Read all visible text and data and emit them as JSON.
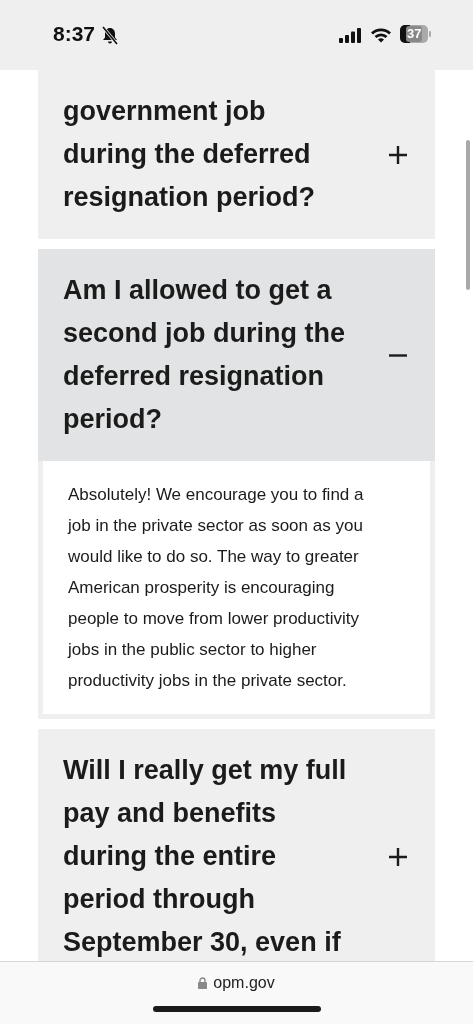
{
  "status_bar": {
    "time": "8:37",
    "battery": "37"
  },
  "faq": [
    {
      "question": "government job during the deferred resignation period?",
      "expanded": false
    },
    {
      "question": "Am I allowed to get a second job during the deferred resignation period?",
      "expanded": true,
      "answer": "Absolutely! We encourage you to find a job in the private sector as soon as you would like to do so. The way to greater American prosperity is encouraging people to move from lower productivity jobs in the public sector to higher productivity jobs in the private sector."
    },
    {
      "question": "Will I really get my full pay and benefits during the entire period through September 30, even if",
      "expanded": false
    }
  ],
  "address_bar": {
    "url": "opm.gov"
  }
}
